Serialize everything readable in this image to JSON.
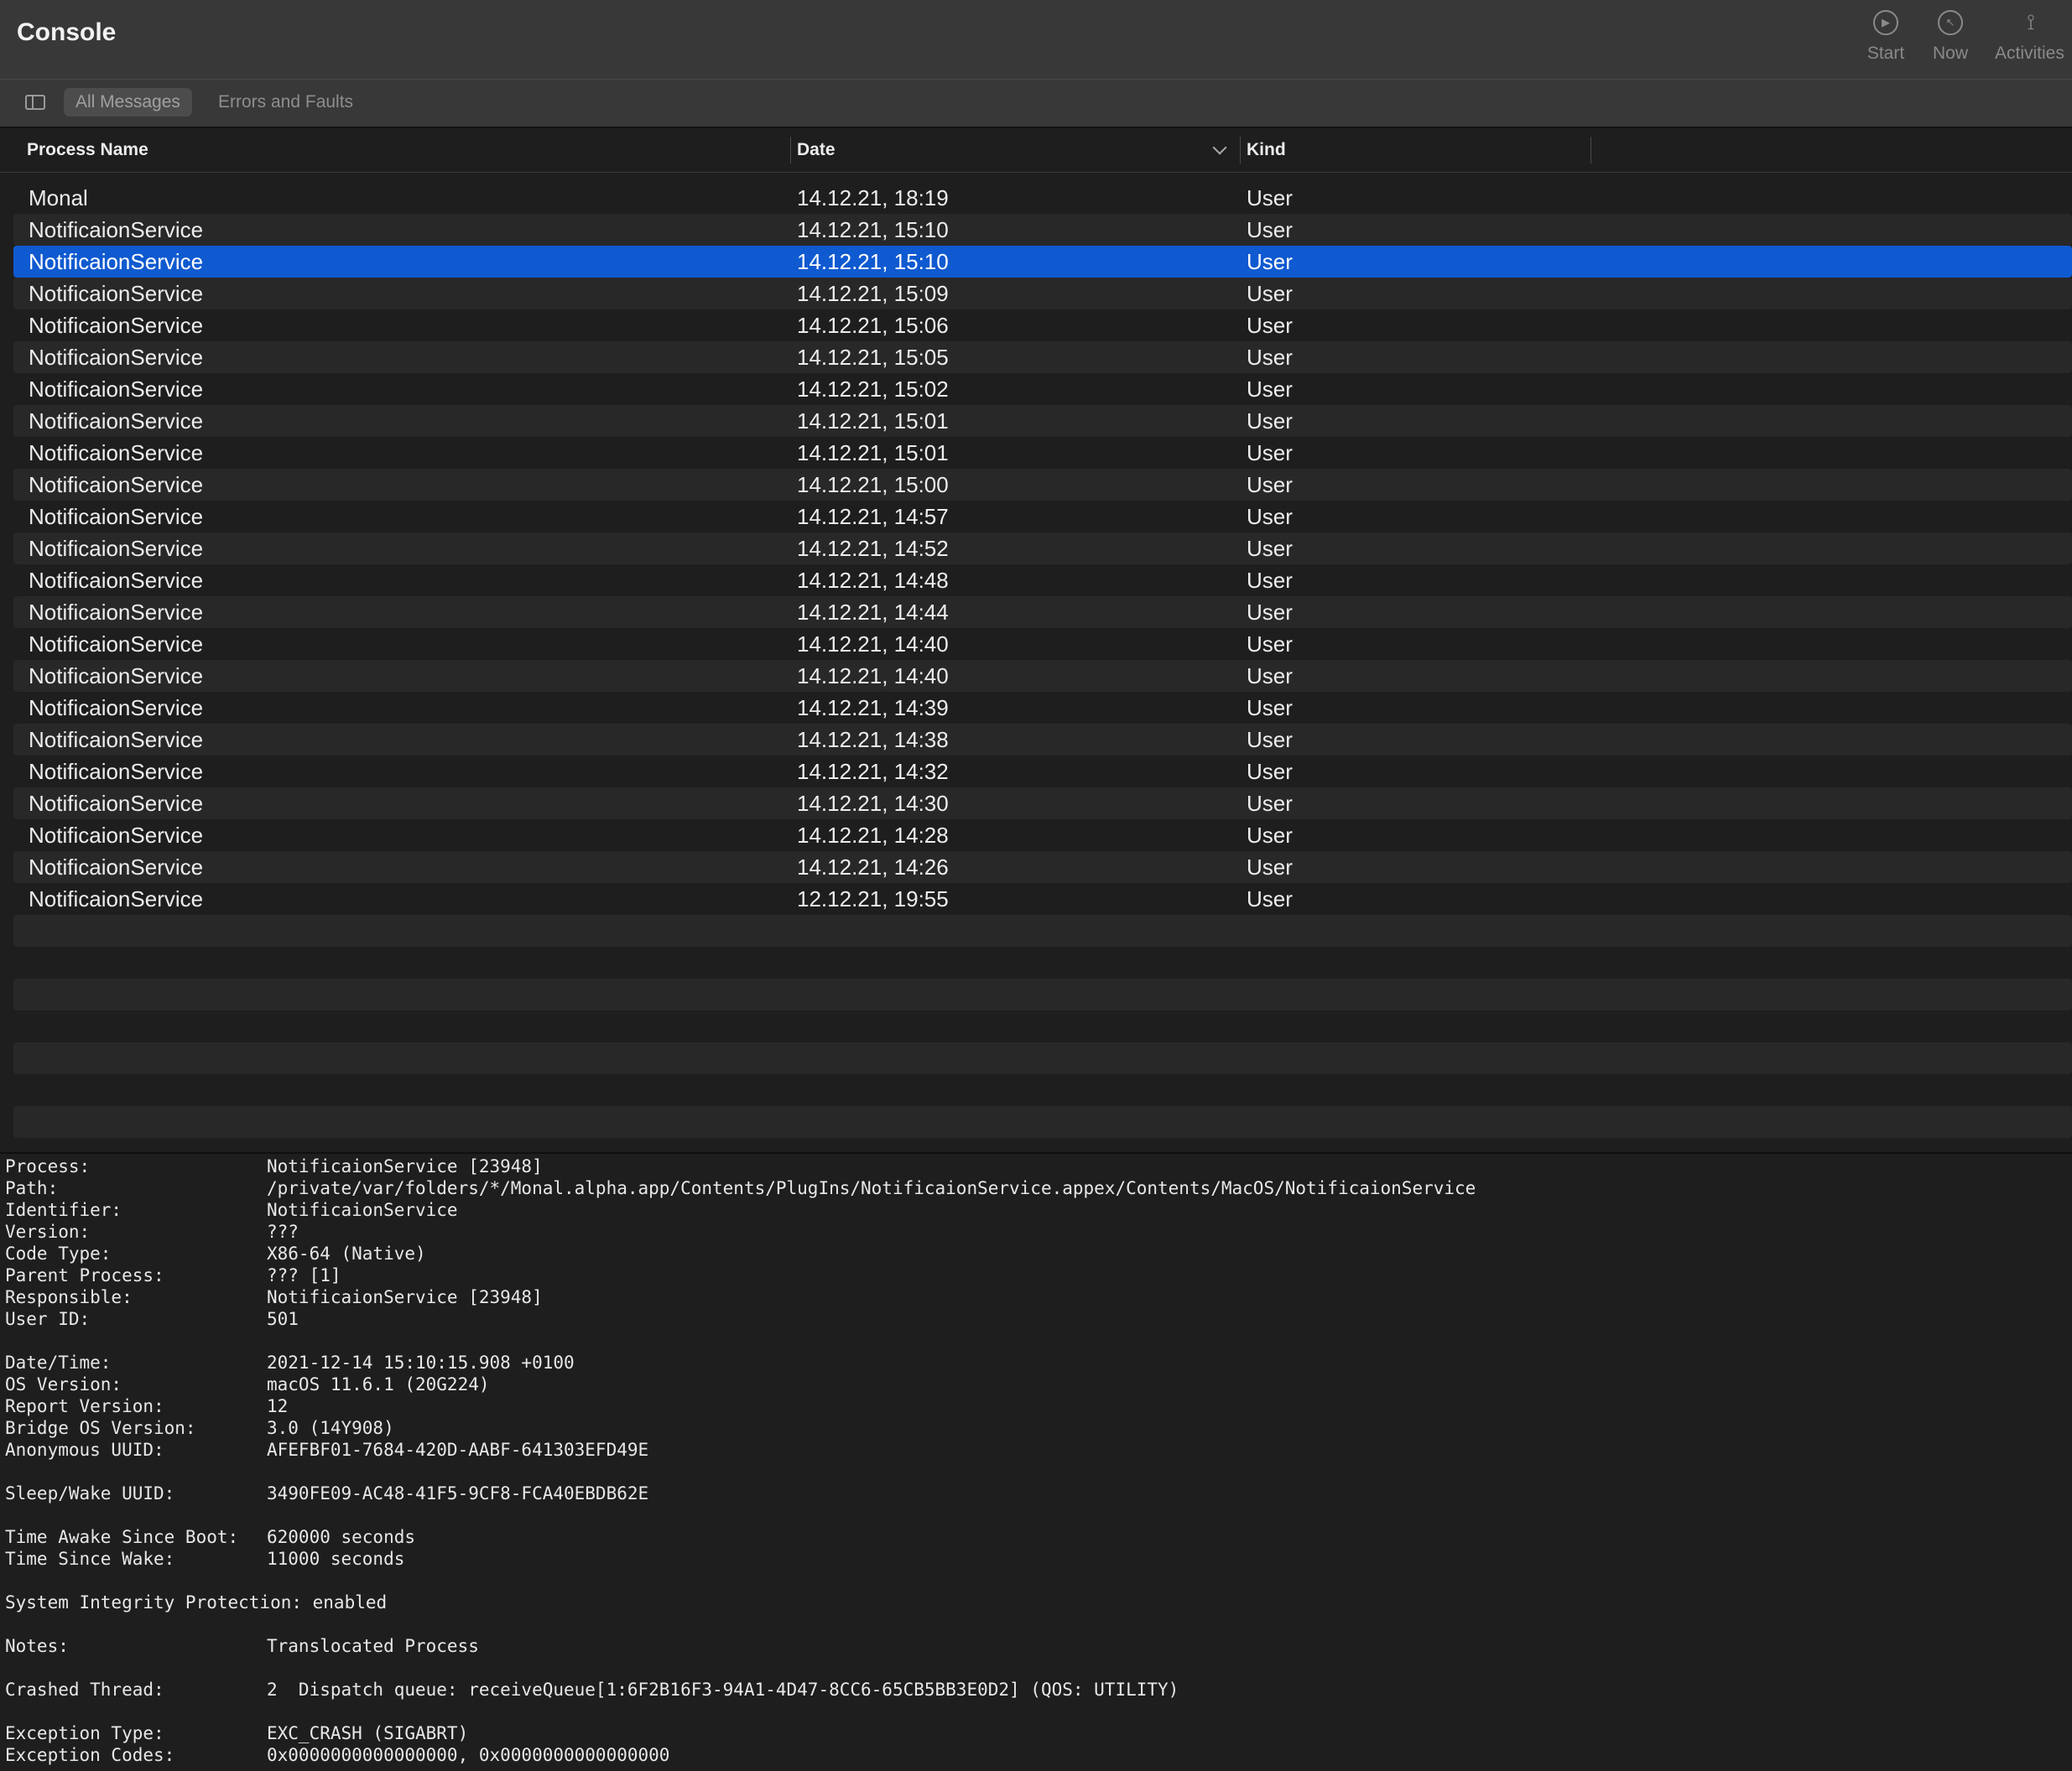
{
  "window": {
    "title": "Console"
  },
  "toolbar": {
    "start_label": "Start",
    "now_label": "Now",
    "activities_label": "Activities"
  },
  "filters": {
    "all_messages": "All Messages",
    "errors_and_faults": "Errors and Faults"
  },
  "table": {
    "columns": [
      "Process Name",
      "Date",
      "Kind"
    ],
    "rows": [
      {
        "process": "Monal",
        "date": "14.12.21, 18:19",
        "kind": "User"
      },
      {
        "process": "NotificaionService",
        "date": "14.12.21, 15:10",
        "kind": "User"
      },
      {
        "process": "NotificaionService",
        "date": "14.12.21, 15:10",
        "kind": "User"
      },
      {
        "process": "NotificaionService",
        "date": "14.12.21, 15:09",
        "kind": "User"
      },
      {
        "process": "NotificaionService",
        "date": "14.12.21, 15:06",
        "kind": "User"
      },
      {
        "process": "NotificaionService",
        "date": "14.12.21, 15:05",
        "kind": "User"
      },
      {
        "process": "NotificaionService",
        "date": "14.12.21, 15:02",
        "kind": "User"
      },
      {
        "process": "NotificaionService",
        "date": "14.12.21, 15:01",
        "kind": "User"
      },
      {
        "process": "NotificaionService",
        "date": "14.12.21, 15:01",
        "kind": "User"
      },
      {
        "process": "NotificaionService",
        "date": "14.12.21, 15:00",
        "kind": "User"
      },
      {
        "process": "NotificaionService",
        "date": "14.12.21, 14:57",
        "kind": "User"
      },
      {
        "process": "NotificaionService",
        "date": "14.12.21, 14:52",
        "kind": "User"
      },
      {
        "process": "NotificaionService",
        "date": "14.12.21, 14:48",
        "kind": "User"
      },
      {
        "process": "NotificaionService",
        "date": "14.12.21, 14:44",
        "kind": "User"
      },
      {
        "process": "NotificaionService",
        "date": "14.12.21, 14:40",
        "kind": "User"
      },
      {
        "process": "NotificaionService",
        "date": "14.12.21, 14:40",
        "kind": "User"
      },
      {
        "process": "NotificaionService",
        "date": "14.12.21, 14:39",
        "kind": "User"
      },
      {
        "process": "NotificaionService",
        "date": "14.12.21, 14:38",
        "kind": "User"
      },
      {
        "process": "NotificaionService",
        "date": "14.12.21, 14:32",
        "kind": "User"
      },
      {
        "process": "NotificaionService",
        "date": "14.12.21, 14:30",
        "kind": "User"
      },
      {
        "process": "NotificaionService",
        "date": "14.12.21, 14:28",
        "kind": "User"
      },
      {
        "process": "NotificaionService",
        "date": "14.12.21, 14:26",
        "kind": "User"
      },
      {
        "process": "NotificaionService",
        "date": "12.12.21, 19:55",
        "kind": "User"
      }
    ],
    "selected_index": 2
  },
  "details": [
    {
      "k": "Process:",
      "v": "NotificaionService [23948]"
    },
    {
      "k": "Path:",
      "v": "/private/var/folders/*/Monal.alpha.app/Contents/PlugIns/NotificaionService.appex/Contents/MacOS/NotificaionService"
    },
    {
      "k": "Identifier:",
      "v": "NotificaionService"
    },
    {
      "k": "Version:",
      "v": "???"
    },
    {
      "k": "Code Type:",
      "v": "X86-64 (Native)"
    },
    {
      "k": "Parent Process:",
      "v": "??? [1]"
    },
    {
      "k": "Responsible:",
      "v": "NotificaionService [23948]"
    },
    {
      "k": "User ID:",
      "v": "501"
    },
    null,
    {
      "k": "Date/Time:",
      "v": "2021-12-14 15:10:15.908 +0100"
    },
    {
      "k": "OS Version:",
      "v": "macOS 11.6.1 (20G224)"
    },
    {
      "k": "Report Version:",
      "v": "12"
    },
    {
      "k": "Bridge OS Version:",
      "v": "3.0 (14Y908)"
    },
    {
      "k": "Anonymous UUID:",
      "v": "AFEFBF01-7684-420D-AABF-641303EFD49E"
    },
    null,
    {
      "k": "Sleep/Wake UUID:",
      "v": "3490FE09-AC48-41F5-9CF8-FCA40EBDB62E"
    },
    null,
    {
      "k": "Time Awake Since Boot:",
      "v": "620000 seconds"
    },
    {
      "k": "Time Since Wake:",
      "v": "11000 seconds"
    },
    null,
    {
      "k": "System Integrity Protection: enabled",
      "v": ""
    },
    null,
    {
      "k": "Notes:",
      "v": "Translocated Process"
    },
    null,
    {
      "k": "Crashed Thread:",
      "v": "2  Dispatch queue: receiveQueue[1:6F2B16F3-94A1-4D47-8CC6-65CB5BB3E0D2] (QOS: UTILITY)"
    },
    null,
    {
      "k": "Exception Type:",
      "v": "EXC_CRASH (SIGABRT)"
    },
    {
      "k": "Exception Codes:",
      "v": "0x0000000000000000, 0x0000000000000000"
    }
  ],
  "colors": {
    "selection": "#0f5ad0",
    "toolbar_bg": "#383838",
    "background": "#1e1e1e"
  },
  "icons": [
    "sidebar-toggle-icon",
    "play-icon",
    "now-icon",
    "activities-icon",
    "sort-chevron-icon"
  ]
}
